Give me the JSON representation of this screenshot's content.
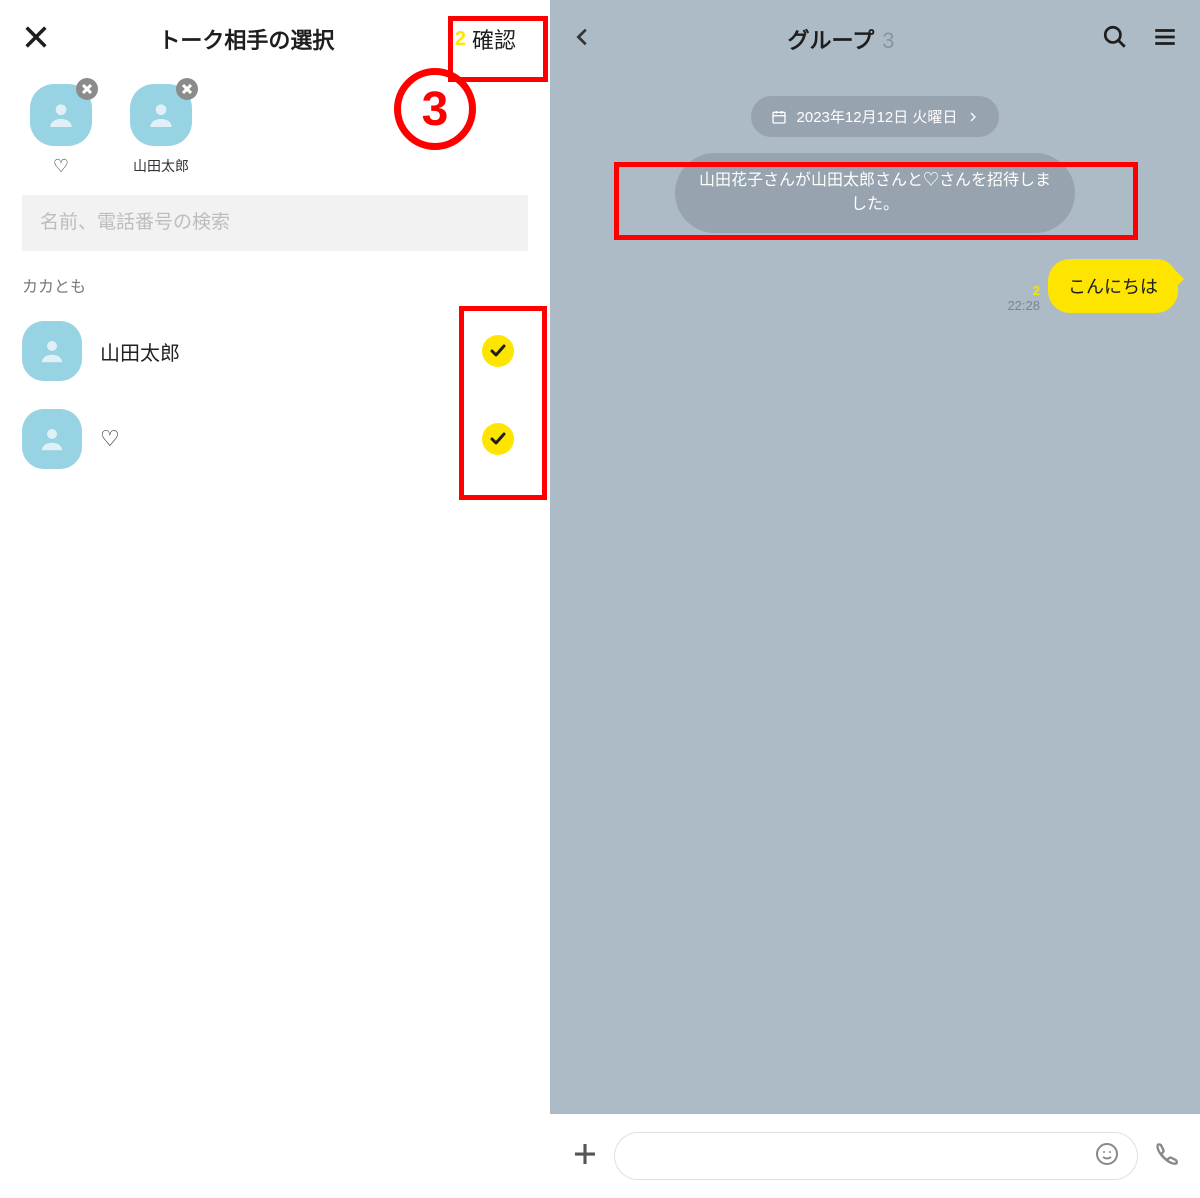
{
  "left": {
    "title": "トーク相手の選択",
    "confirm_count": "2",
    "confirm_label": "確認",
    "chips": [
      {
        "label": "♡",
        "is_heart": true
      },
      {
        "label": "山田太郎",
        "is_heart": false
      }
    ],
    "search_placeholder": "名前、電話番号の検索",
    "section_label": "カカとも",
    "contacts": [
      {
        "name": "山田太郎",
        "is_heart": false,
        "checked": true
      },
      {
        "name": "♡",
        "is_heart": true,
        "checked": true
      }
    ],
    "callout_number": "3"
  },
  "right": {
    "title": "グループ",
    "member_count": "3",
    "date_pill": "2023年12月12日 火曜日",
    "system_message": "山田花子さんが山田太郎さんと♡さんを招待しました。",
    "message": {
      "unread": "2",
      "time": "22:28",
      "text": "こんにちは"
    },
    "input_placeholder": ""
  }
}
